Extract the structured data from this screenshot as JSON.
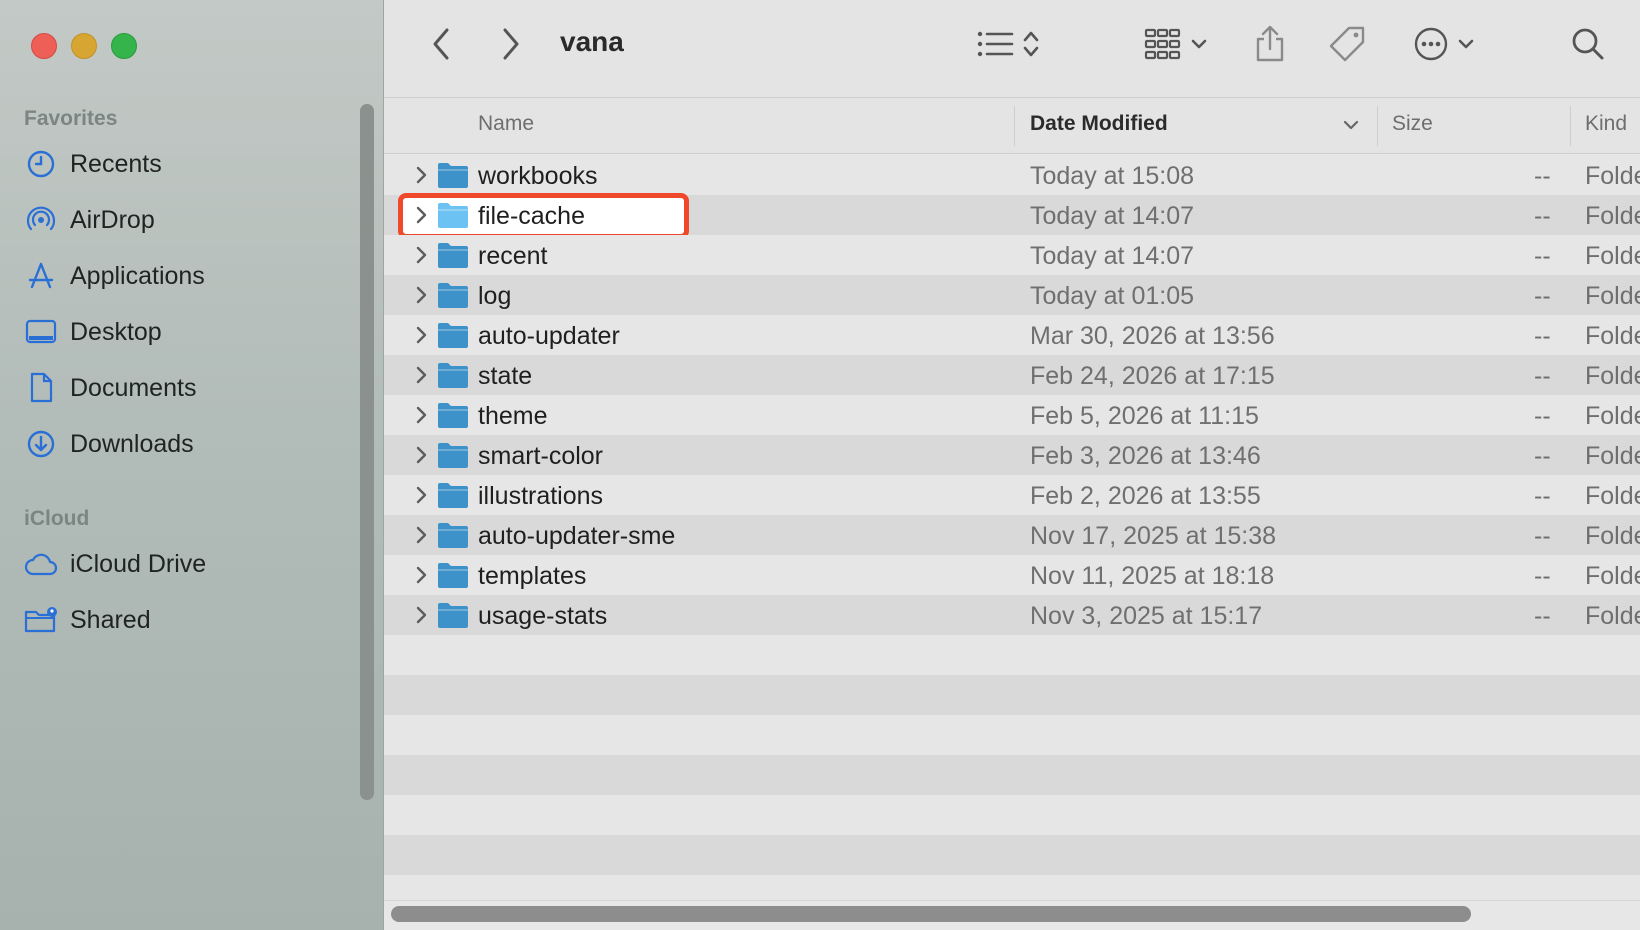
{
  "window": {
    "title": "vana"
  },
  "sidebar": {
    "favorites_label": "Favorites",
    "favorites": [
      {
        "label": "Recents",
        "icon": "clock-icon"
      },
      {
        "label": "AirDrop",
        "icon": "airdrop-icon"
      },
      {
        "label": "Applications",
        "icon": "applications-icon"
      },
      {
        "label": "Desktop",
        "icon": "desktop-icon"
      },
      {
        "label": "Documents",
        "icon": "document-icon"
      },
      {
        "label": "Downloads",
        "icon": "download-icon"
      }
    ],
    "icloud_label": "iCloud",
    "icloud": [
      {
        "label": "iCloud Drive",
        "icon": "cloud-icon"
      },
      {
        "label": "Shared",
        "icon": "shared-folder-icon"
      }
    ]
  },
  "columns": {
    "name": "Name",
    "date_modified": "Date Modified",
    "size": "Size",
    "kind": "Kind"
  },
  "rows": [
    {
      "name": "workbooks",
      "date": "Today at 15:08",
      "size": "--",
      "kind": "Folder"
    },
    {
      "name": "file-cache",
      "date": "Today at 14:07",
      "size": "--",
      "kind": "Folder"
    },
    {
      "name": "recent",
      "date": "Today at 14:07",
      "size": "--",
      "kind": "Folder"
    },
    {
      "name": "log",
      "date": "Today at 01:05",
      "size": "--",
      "kind": "Folder"
    },
    {
      "name": "auto-updater",
      "date": "Mar 30, 2026 at 13:56",
      "size": "--",
      "kind": "Folder"
    },
    {
      "name": "state",
      "date": "Feb 24, 2026 at 17:15",
      "size": "--",
      "kind": "Folder"
    },
    {
      "name": "theme",
      "date": "Feb 5, 2026 at 11:15",
      "size": "--",
      "kind": "Folder"
    },
    {
      "name": "smart-color",
      "date": "Feb 3, 2026 at 13:46",
      "size": "--",
      "kind": "Folder"
    },
    {
      "name": "illustrations",
      "date": "Feb 2, 2026 at 13:55",
      "size": "--",
      "kind": "Folder"
    },
    {
      "name": "auto-updater-sme",
      "date": "Nov 17, 2025 at 15:38",
      "size": "--",
      "kind": "Folder"
    },
    {
      "name": "templates",
      "date": "Nov 11, 2025 at 18:18",
      "size": "--",
      "kind": "Folder"
    },
    {
      "name": "usage-stats",
      "date": "Nov 3, 2025 at 15:17",
      "size": "--",
      "kind": "Folder"
    }
  ],
  "selected_row": "file-cache",
  "colors": {
    "highlight": "#f0482b",
    "folder": "#3d93c9",
    "accent": "#2a6fd6"
  }
}
